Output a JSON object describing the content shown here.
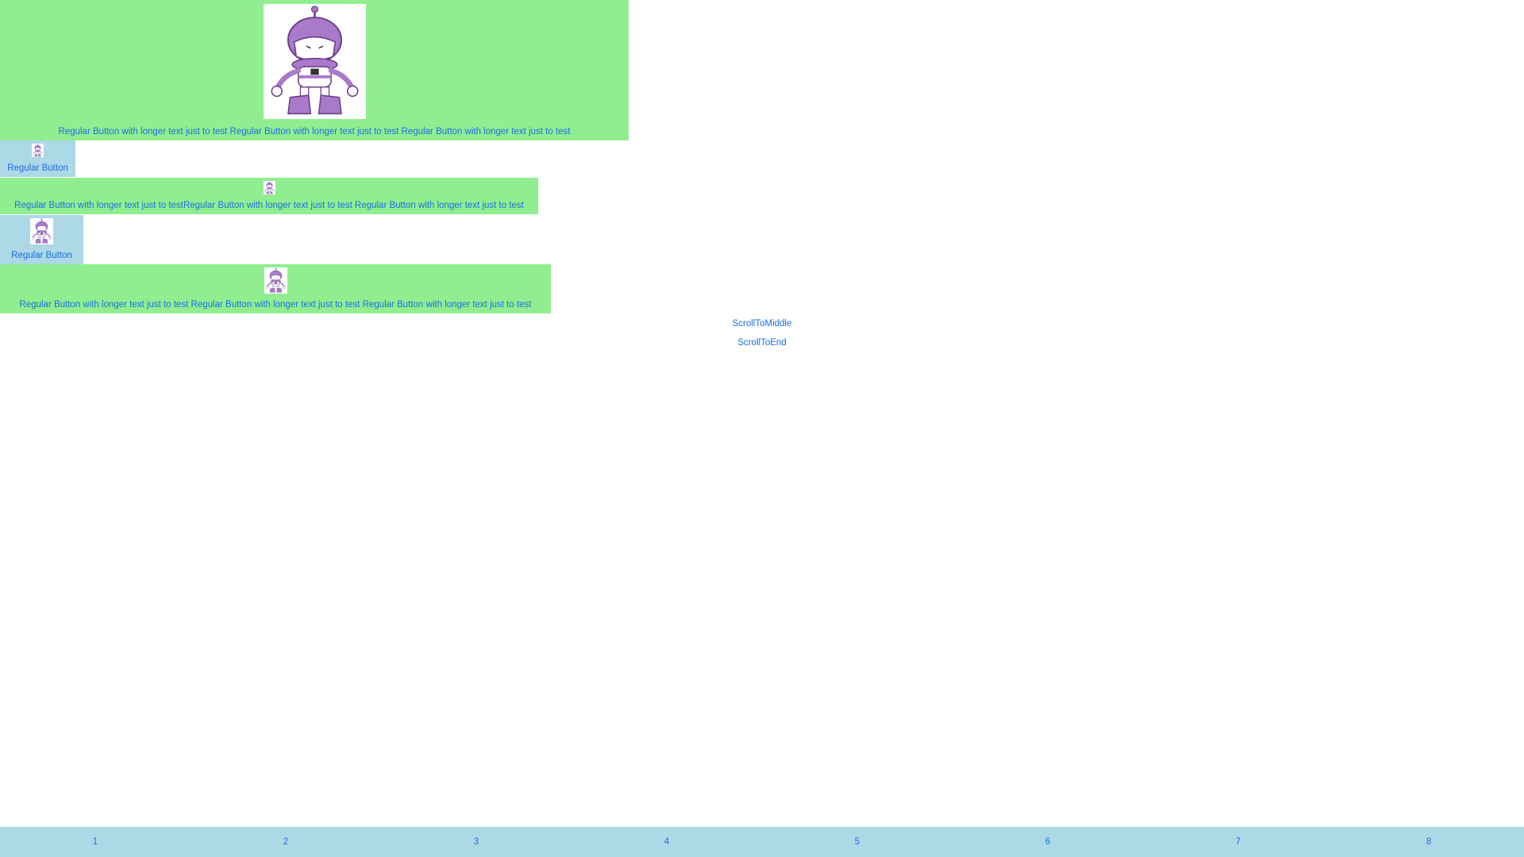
{
  "buttons": [
    {
      "label": "Regular Button with longer text just to test Regular Button with longer text just to test Regular Button with longer text just to test",
      "image": "robot-image"
    },
    {
      "label": "Regular Button",
      "image": "robot-image"
    },
    {
      "label": "Regular Button with longer text just to testRegular Button with longer text just to test Regular Button with longer text just to test",
      "image": "robot-image"
    },
    {
      "label": "Regular Button",
      "image": "robot-image"
    },
    {
      "label": "Regular Button with longer text just to test Regular Button with longer text just to test Regular Button with longer text just to test",
      "image": "robot-image"
    }
  ],
  "links": {
    "scroll_middle": "ScrollToMiddle",
    "scroll_end": "ScrollToEnd"
  },
  "tabs": [
    "1",
    "2",
    "3",
    "4",
    "5",
    "6",
    "7",
    "8"
  ],
  "colors": {
    "green": "#90ee90",
    "blue": "#add8e6",
    "text": "#1a6fe0",
    "robot": "#a97ac9"
  }
}
